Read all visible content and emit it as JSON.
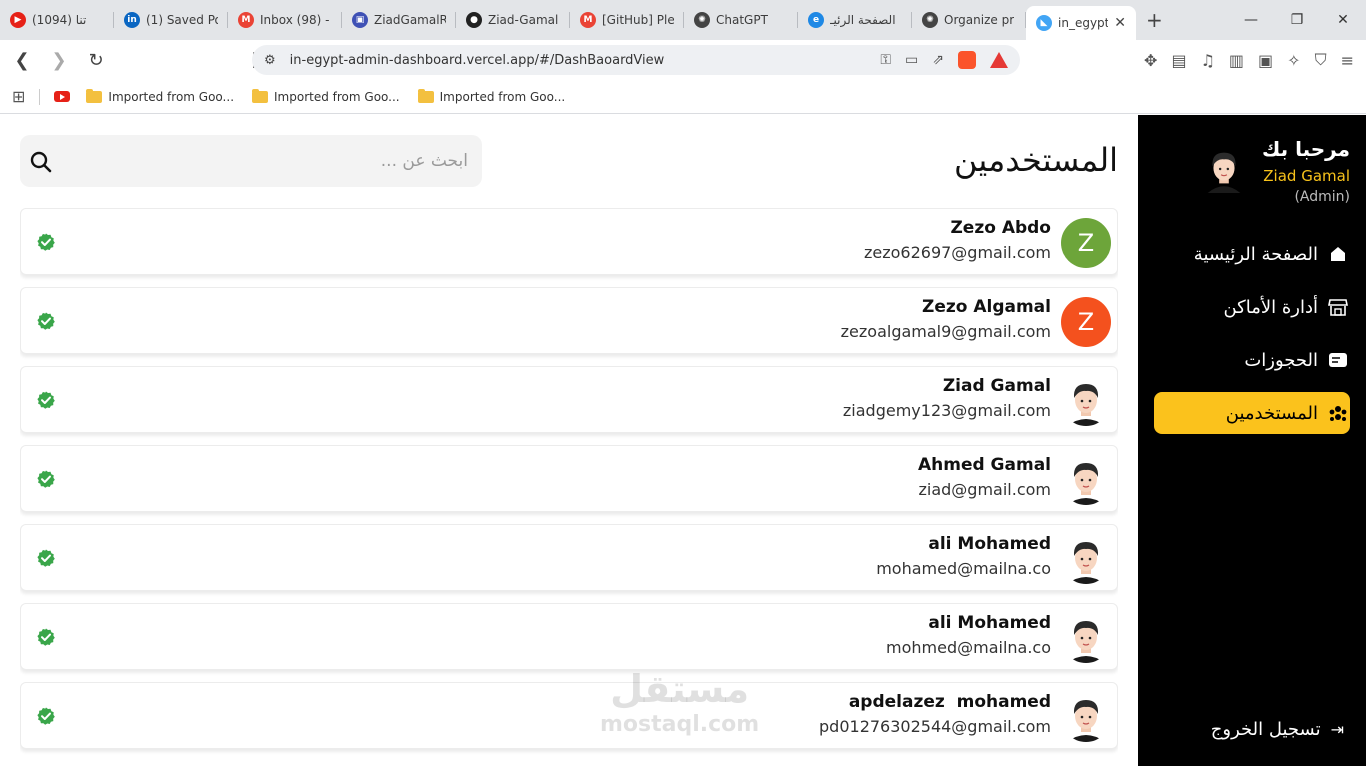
{
  "browser": {
    "tabs": [
      {
        "label": "(1094) تنا",
        "icon": "youtube-icon",
        "color": "#e62117",
        "glyph": "▶"
      },
      {
        "label": "(1) Saved Po",
        "icon": "linkedin-icon",
        "color": "#0a66c2",
        "glyph": "in"
      },
      {
        "label": "Inbox (98) -",
        "icon": "gmail-icon",
        "color": "#ea4335",
        "glyph": "M"
      },
      {
        "label": "ZiadGamalR",
        "icon": "web-icon",
        "color": "#3f51b5",
        "glyph": "▣"
      },
      {
        "label": "Ziad-Gamal",
        "icon": "github-icon",
        "color": "#222222",
        "glyph": "●"
      },
      {
        "label": "[GitHub] Ple",
        "icon": "gmail-icon",
        "color": "#ea4335",
        "glyph": "M"
      },
      {
        "label": "ChatGPT",
        "icon": "chatgpt-icon",
        "color": "#444444",
        "glyph": "✺"
      },
      {
        "label": "الصفحة الرئيـ",
        "icon": "site-icon",
        "color": "#1e88e5",
        "glyph": "e"
      },
      {
        "label": "Organize pr",
        "icon": "chatgpt-icon",
        "color": "#444444",
        "glyph": "✺"
      },
      {
        "label": "in_egypt",
        "icon": "flutter-icon",
        "color": "#42a5f5",
        "glyph": "◣",
        "active": true
      }
    ],
    "url": "in-egypt-admin-dashboard.vercel.app/#/DashBaoardView",
    "bookmarks": [
      "Imported from Goo...",
      "Imported from Goo...",
      "Imported from Goo..."
    ]
  },
  "sidebar": {
    "welcome": "مرحبا بك",
    "user_name": "Ziad Gamal",
    "user_role": "(Admin)",
    "menu": [
      {
        "label": "الصفحة الرئيسية",
        "icon": "home-icon",
        "active": false
      },
      {
        "label": "أدارة الأماكن",
        "icon": "store-icon",
        "active": false
      },
      {
        "label": "الحجوزات",
        "icon": "bookings-icon",
        "active": false
      },
      {
        "label": "المستخدمين",
        "icon": "users-icon",
        "active": true
      }
    ],
    "logout_label": "تسجيل الخروج",
    "active_color": "#fbc21c"
  },
  "main": {
    "title": "المستخدمين",
    "search_placeholder": "ابحث عن ...",
    "users": [
      {
        "name": "Zezo Abdo",
        "email": "zezo62697@gmail.com",
        "avatar": "letter",
        "letter": "Z",
        "color": "#6da53a",
        "verified": true
      },
      {
        "name": "Zezo Algamal",
        "email": "zezoalgamal9@gmail.com",
        "avatar": "letter",
        "letter": "Z",
        "color": "#f4511e",
        "verified": true
      },
      {
        "name": "Ziad Gamal",
        "email": "ziadgemy123@gmail.com",
        "avatar": "cartoon",
        "verified": true
      },
      {
        "name": "Ahmed Gamal",
        "email": "ziad@gmail.com",
        "avatar": "cartoon",
        "verified": true
      },
      {
        "name": "ali Mohamed",
        "email": "mohamed@mailna.co",
        "avatar": "cartoon",
        "verified": true
      },
      {
        "name": "ali Mohamed",
        "email": "mohmed@mailna.co",
        "avatar": "cartoon",
        "verified": true
      },
      {
        "name": "apdelazez  mohamed",
        "email": "pd01276302544@gmail.com",
        "avatar": "cartoon",
        "verified": true
      }
    ]
  },
  "watermark": {
    "brand": "مستقل",
    "domain": "mostaql.com"
  }
}
